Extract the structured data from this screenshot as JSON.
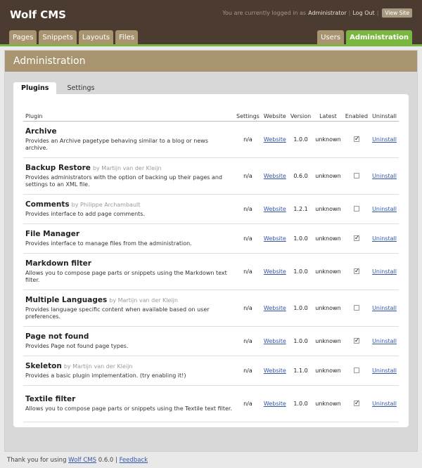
{
  "header": {
    "logo": "Wolf CMS",
    "login_prefix": "You are currently logged in as",
    "user": "Administrator",
    "sep": "|",
    "logout": "Log Out",
    "view_site": "View Site"
  },
  "nav": {
    "left_tabs": [
      "Pages",
      "Snippets",
      "Layouts",
      "Files"
    ],
    "right_tabs": [
      "Users",
      "Administration"
    ]
  },
  "main": {
    "title": "Administration",
    "subtabs": [
      "Plugins",
      "Settings"
    ]
  },
  "table": {
    "headers": [
      "Plugin",
      "Settings",
      "Website",
      "Version",
      "Latest",
      "Enabled",
      "Uninstall"
    ],
    "rows": [
      {
        "name": "Archive",
        "author": "",
        "desc": "Provides an Archive pagetype behaving similar to a blog or news archive.",
        "settings": "n/a",
        "website": "Website",
        "version": "1.0.0",
        "latest": "unknown",
        "enabled": true,
        "uninstall": "Uninstall"
      },
      {
        "name": "Backup Restore",
        "author": "by Martijn van der Kleijn",
        "desc": "Provides administrators with the option of backing up their pages and settings to an XML file.",
        "settings": "n/a",
        "website": "Website",
        "version": "0.6.0",
        "latest": "unknown",
        "enabled": false,
        "uninstall": "Uninstall"
      },
      {
        "name": "Comments",
        "author": "by Philippe Archambault",
        "desc": "Provides interface to add page comments.",
        "settings": "n/a",
        "website": "Website",
        "version": "1.2.1",
        "latest": "unknown",
        "enabled": false,
        "uninstall": "Uninstall"
      },
      {
        "name": "File Manager",
        "author": "",
        "desc": "Provides interface to manage files from the administration.",
        "settings": "n/a",
        "website": "Website",
        "version": "1.0.0",
        "latest": "unknown",
        "enabled": true,
        "uninstall": "Uninstall"
      },
      {
        "name": "Markdown filter",
        "author": "",
        "desc": "Allows you to compose page parts or snippets using the Markdown text filter.",
        "settings": "n/a",
        "website": "Website",
        "version": "1.0.0",
        "latest": "unknown",
        "enabled": true,
        "uninstall": "Uninstall"
      },
      {
        "name": "Multiple Languages",
        "author": "by Martijn van der Kleijn",
        "desc": "Provides language specific content when available based on user preferences.",
        "settings": "n/a",
        "website": "Website",
        "version": "1.0.0",
        "latest": "unknown",
        "enabled": false,
        "uninstall": "Uninstall"
      },
      {
        "name": "Page not found",
        "author": "",
        "desc": "Provides Page not found page types.",
        "settings": "n/a",
        "website": "Website",
        "version": "1.0.0",
        "latest": "unknown",
        "enabled": true,
        "uninstall": "Uninstall"
      },
      {
        "name": "Skeleton",
        "author": "by Martijn van der Kleijn",
        "desc": "Provides a basic plugin implementation. (try enabling it!)",
        "settings": "n/a",
        "website": "Website",
        "version": "1.1.0",
        "latest": "unknown",
        "enabled": false,
        "uninstall": "Uninstall"
      },
      {
        "name": "Textile filter",
        "author": "",
        "desc": "Allows you to compose page parts or snippets using the Textile text filter.",
        "settings": "n/a",
        "website": "Website",
        "version": "1.0.0",
        "latest": "unknown",
        "enabled": true,
        "uninstall": "Uninstall"
      }
    ]
  },
  "footer": {
    "prefix": "Thank you for using",
    "product": "Wolf CMS",
    "version": "0.6.0",
    "sep": "|",
    "feedback": "Feedback"
  }
}
